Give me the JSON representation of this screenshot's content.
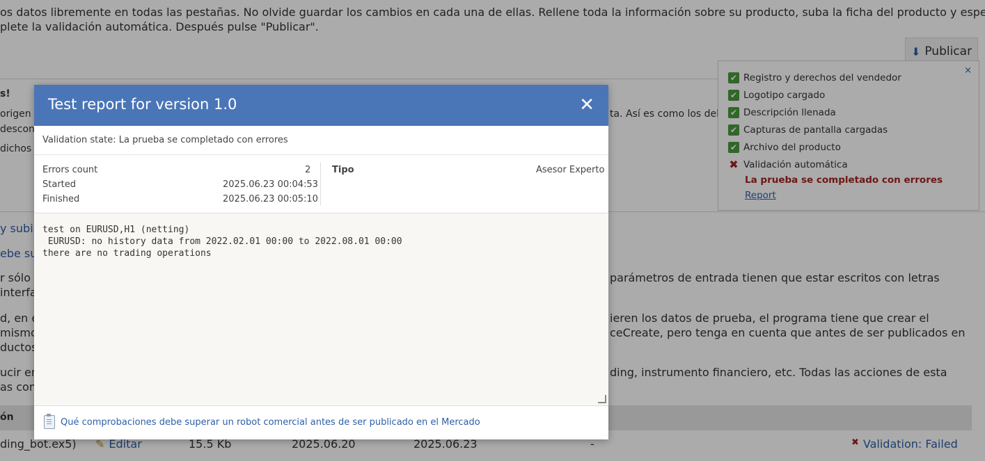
{
  "background": {
    "intro_line1": "os datos libremente en todas las pestañas. No olvide guardar los cambios en cada una de ellas. Rellene toda la información sobre su producto, suba la ficha del producto y espere",
    "intro_line2": "plete la validación automática. Después pulse \"Publicar\".",
    "publish_button": "Publicar",
    "warn_heading": "s!",
    "warn_line1": "origen",
    "warn_line1_tail": "ta. Así es como los delir",
    "warn_line2": "descon",
    "warn_line3": "dichos",
    "link1": "y subir",
    "link2": "ebe sup",
    "para1_left": "r sólo",
    "para1_left2": "interfa",
    "para1_right": "parámetros de entrada tienen que estar escritos con letras",
    "para2_left": "d, en e",
    "para2_left2": "mismo",
    "para2_left3": "ductos",
    "para2_right": "ieren los datos de prueba, el programa tiene que crear el",
    "para2_right2": "ceCreate, pero tenga en cuenta que antes de ser publicados en",
    "para3_left": "ucir en",
    "para3_left2": "as com",
    "para3_right": "ding, instrumento financiero, etc. Todas las acciones de esta",
    "table_header": "ón",
    "file_name": "ding_bot.ex5)",
    "edit_label": "Editar",
    "file_size": "15.5 Kb",
    "date1": "2025.06.20",
    "date2": "2025.06.23",
    "dash": "-",
    "validation_status": "Validation: Failed"
  },
  "checklist": {
    "close": "×",
    "items": [
      {
        "label": "Registro y derechos del vendedor",
        "ok": true
      },
      {
        "label": "Logotipo cargado",
        "ok": true
      },
      {
        "label": "Descripción llenada",
        "ok": true
      },
      {
        "label": "Capturas de pantalla cargadas",
        "ok": true
      },
      {
        "label": "Archivo del producto",
        "ok": true
      },
      {
        "label": "Validación automática",
        "ok": false
      }
    ],
    "error_text": "La prueba se completado con errores",
    "report_link": "Report"
  },
  "modal": {
    "title": "Test report for version 1.0",
    "close": "✕",
    "validation_state": "Validation state: La prueba se completado con errores",
    "errors_count_label": "Errors count",
    "errors_count_value": "2",
    "started_label": "Started",
    "started_value": "2025.06.23 00:04:53",
    "finished_label": "Finished",
    "finished_value": "2025.06.23 00:05:10",
    "tipo_label": "Tipo",
    "tipo_value": "Asesor Experto",
    "log": "test on EURUSD,H1 (netting)\n EURUSD: no history data from 2022.02.01 00:00 to 2022.08.01 00:00\nthere are no trading operations",
    "footer_link": "Qué comprobaciones debe superar un robot comercial antes de ser publicado en el Mercado"
  },
  "colors": {
    "header_blue": "#4a76b8",
    "link_blue": "#2d5fa8",
    "error_red": "#a52323",
    "check_green": "#4a9a3c"
  }
}
